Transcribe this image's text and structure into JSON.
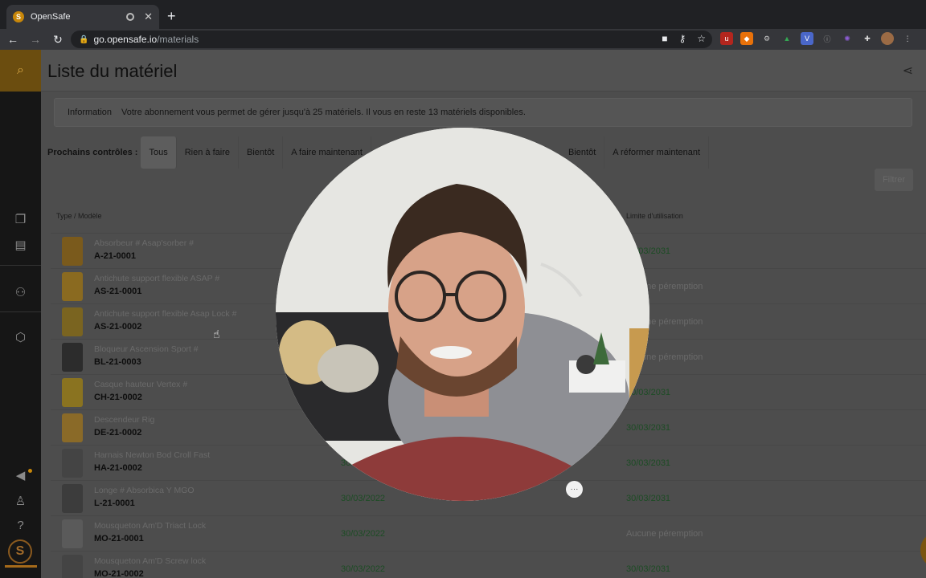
{
  "browser": {
    "tab_title": "OpenSafe",
    "url_host": "go.opensafe.io",
    "url_path": "/materials"
  },
  "page": {
    "title": "Liste du matériel",
    "info_label": "Information",
    "info_text": "Votre abonnement vous permet de gérer jusqu'à 25 matériels. Il vous en reste 13 matériels disponibles.",
    "filters_label": "Prochains contrôles :",
    "filters_left": [
      "Tous",
      "Rien à faire",
      "Bientôt",
      "A faire maintenant"
    ],
    "filters_right": [
      "Bientôt",
      "A réformer maintenant"
    ],
    "filter_button": "Filtrer",
    "col_type": "Type / Modèle",
    "col_limit": "Limite d'utilisation",
    "fab_label": "+"
  },
  "rows": [
    {
      "name": "Absorbeur # Asap'sorber #",
      "code": "A-21-0001",
      "date1": "",
      "date2": "30/03/2031"
    },
    {
      "name": "Antichute support flexible ASAP #",
      "code": "AS-21-0001",
      "date1": "",
      "date2": "Aucune péremption"
    },
    {
      "name": "Antichute support flexible Asap Lock #",
      "code": "AS-21-0002",
      "date1": "",
      "date2": "Aucune péremption"
    },
    {
      "name": "Bloqueur Ascension Sport #",
      "code": "BL-21-0003",
      "date1": "",
      "date2": "Aucune péremption"
    },
    {
      "name": "Casque hauteur Vertex #",
      "code": "CH-21-0002",
      "date1": "",
      "date2": "30/03/2031"
    },
    {
      "name": "Descendeur Rig",
      "code": "DE-21-0002",
      "date1": "",
      "date2": "30/03/2031"
    },
    {
      "name": "Harnais Newton Bod Croll Fast",
      "code": "HA-21-0002",
      "date1": "30/",
      "date2": "30/03/2031"
    },
    {
      "name": "Longe # Absorbica Y MGO",
      "code": "L-21-0001",
      "date1": "30/03/2022",
      "date2": "30/03/2031"
    },
    {
      "name": "Mousqueton Am'D Triact Lock",
      "code": "MO-21-0001",
      "date1": "30/03/2022",
      "date2": "Aucune péremption"
    },
    {
      "name": "Mousqueton Am'D Screw lock",
      "code": "MO-21-0002",
      "date1": "30/03/2022",
      "date2": "30/03/2031"
    }
  ],
  "colors": {
    "accent": "#c8870a",
    "date_green": "#1c4c24"
  },
  "icons": [
    "search-icon",
    "copy-icon",
    "archive-icon",
    "users-icon",
    "box-icon",
    "megaphone-icon",
    "user-icon",
    "help-icon",
    "share-icon",
    "plus-icon",
    "more-icon"
  ]
}
